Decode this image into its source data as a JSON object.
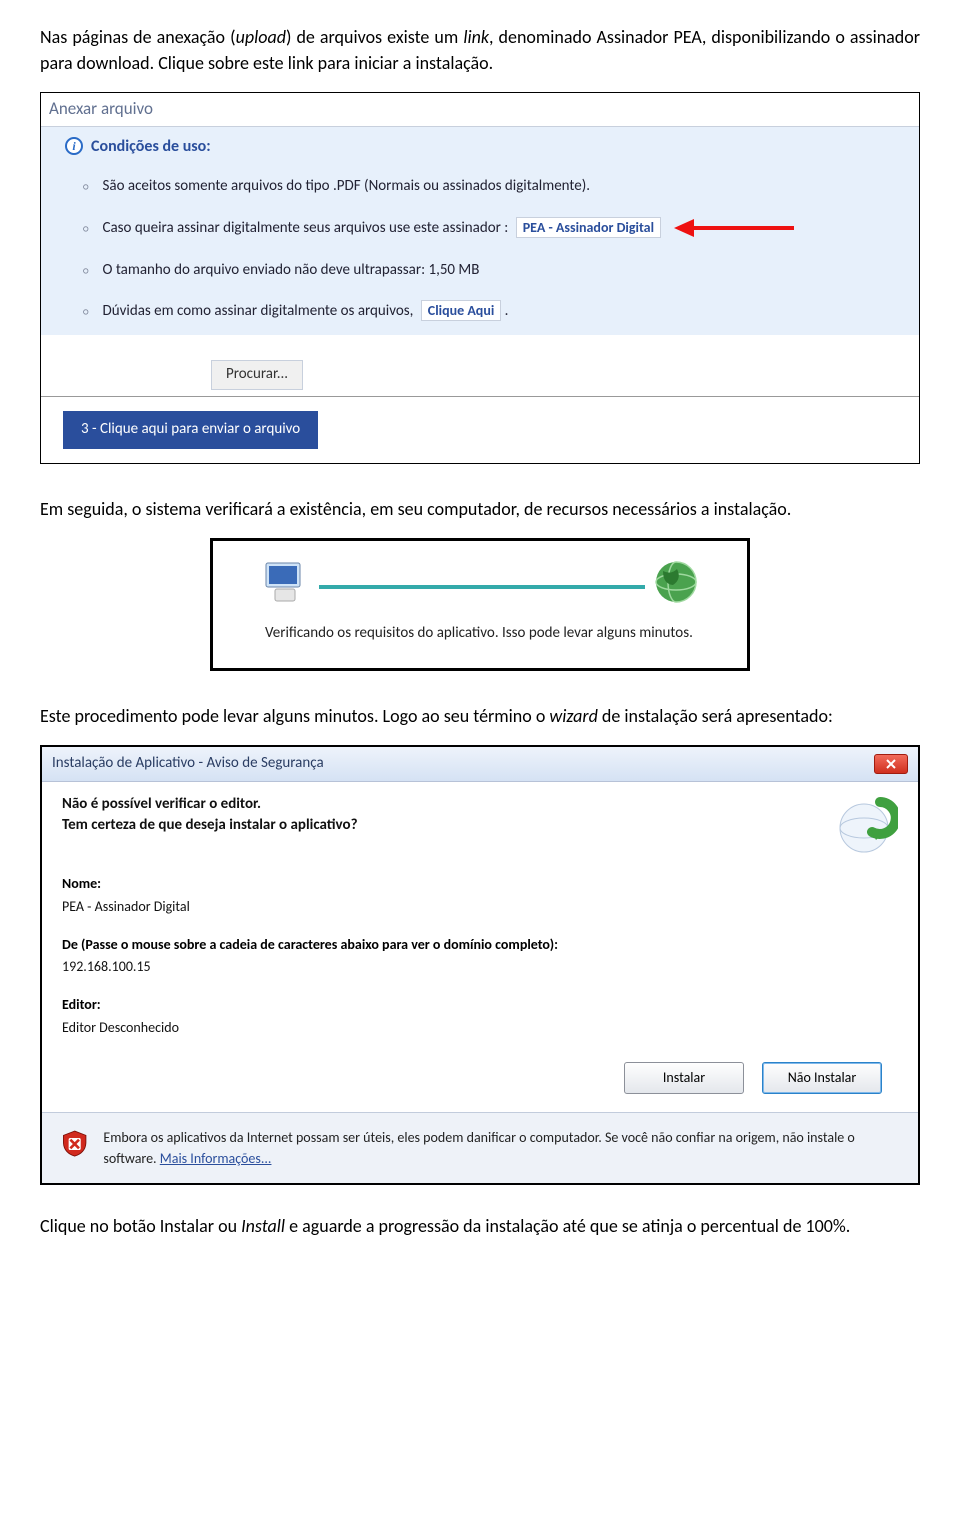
{
  "intro": {
    "p1a": "Nas páginas de anexação (",
    "p1b": "upload",
    "p1c": ") de arquivos existe um ",
    "p1d": "link",
    "p1e": ", denominado Assinador PEA, disponibilizando o assinador para download. Clique sobre este link para iniciar a instalação."
  },
  "shot1": {
    "title": "Anexar arquivo",
    "cond": "Condições de uso:",
    "i1": "São aceitos somente arquivos do tipo .PDF (Normais ou assinados digitalmente).",
    "i2": "Caso queira assinar digitalmente seus arquivos use este assinador :",
    "i2_link": "PEA - Assinador Digital",
    "i3": "O tamanho do arquivo enviado não deve ultrapassar: 1,50 MB",
    "i4": "Dúvidas em como assinar digitalmente os arquivos,",
    "i4_link": "Clique Aqui",
    "procurar": "Procurar...",
    "send": "3 - Clique aqui para enviar o arquivo"
  },
  "mid1": "Em seguida, o sistema verificará a existência, em seu computador, de recursos necessários a instalação.",
  "shot2": {
    "text": "Verificando os requisitos do aplicativo. Isso pode levar alguns minutos."
  },
  "mid2a": "Este procedimento pode levar alguns minutos. Logo ao seu término o ",
  "mid2b": "wizard",
  "mid2c": " de instalação será apresentado:",
  "shot3": {
    "title": "Instalação de Aplicativo - Aviso de Segurança",
    "h1": "Não é possível verificar o editor.",
    "h2": "Tem certeza de que deseja instalar o aplicativo?",
    "lbl_nome": "Nome:",
    "val_nome": "PEA - Assinador Digital",
    "lbl_de": "De (Passe o mouse sobre a cadeia de caracteres abaixo para ver o domínio completo):",
    "val_de": "192.168.100.15",
    "lbl_editor": "Editor:",
    "val_editor": "Editor Desconhecido",
    "btn_install": "Instalar",
    "btn_cancel": "Não Instalar",
    "warn": "Embora os aplicativos da Internet possam ser úteis, eles podem danificar o computador. Se você não confiar na origem, não instale o software. ",
    "warn_link": "Mais Informações..."
  },
  "outro_a": "Clique no botão Instalar ou ",
  "outro_b": "Install",
  "outro_c": " e aguarde a progressão da instalação até que se atinja o percentual de 100%."
}
